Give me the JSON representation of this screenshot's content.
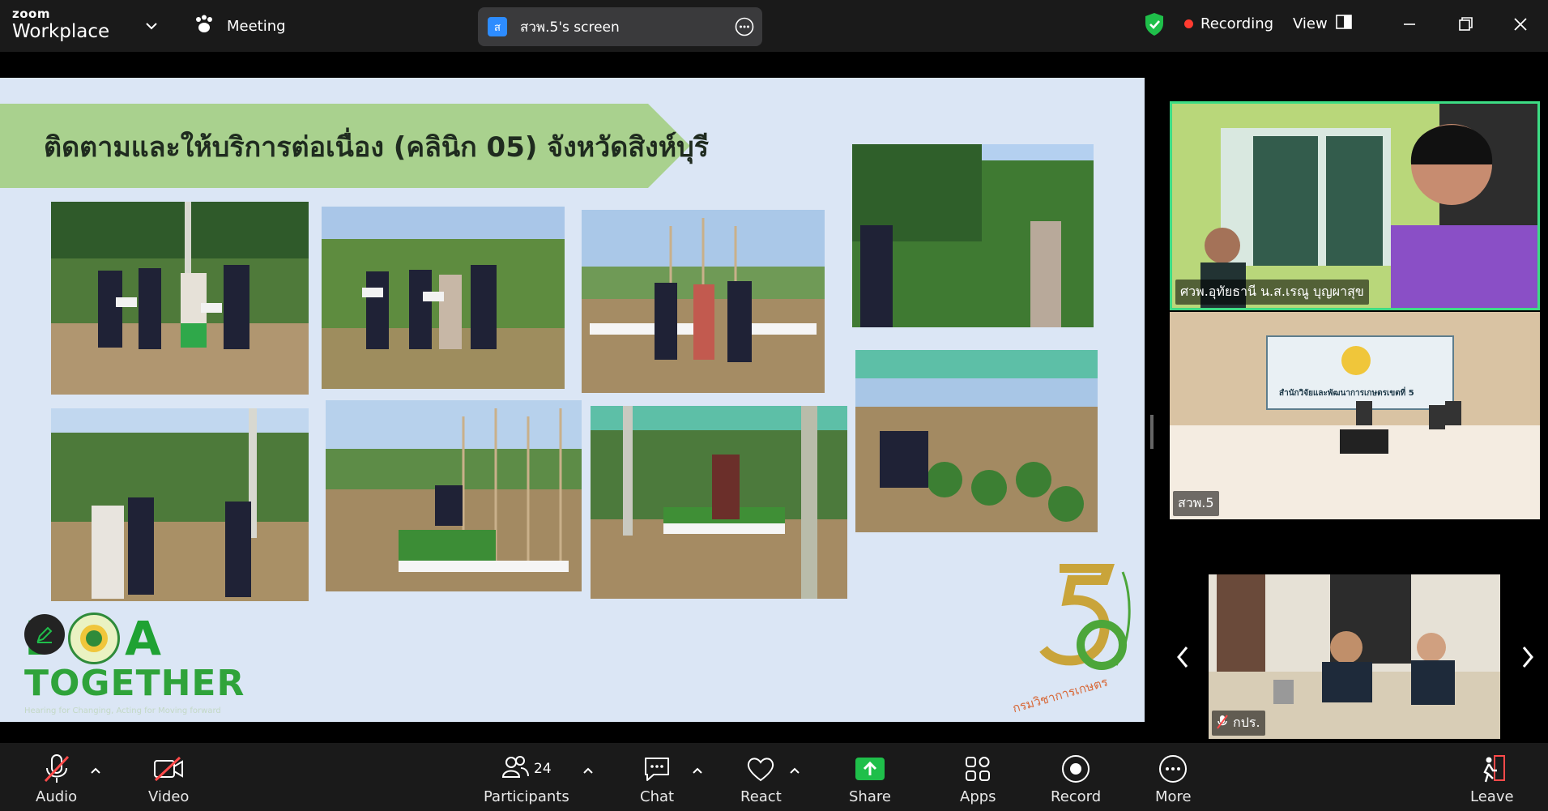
{
  "app": {
    "brand_small": "zoom",
    "brand_big": "Workplace"
  },
  "topbar": {
    "meeting_label": "Meeting",
    "screen_share": {
      "badge": "ส",
      "label": "สวพ.5's screen"
    },
    "recording_label": "Recording",
    "view_label": "View"
  },
  "slide": {
    "title": "ติดตามและให้บริการต่อเนื่อง (คลินิก 05) จังหวัดสิงห์บุรี",
    "logo_letters": [
      "D",
      "A"
    ],
    "logo_word": "TOGETHER",
    "logo_tagline": "Hearing for Changing, Acting for Moving forward",
    "anniv_vertical": "DOA TOGETHER",
    "anniv_dept": "กรมวิชาการเกษตร"
  },
  "gallery": {
    "tiles": [
      {
        "name": "ศวพ.อุทัยธานี น.ส.เรณู บุญผาสุข",
        "muted": false
      },
      {
        "name": "สวพ.5",
        "muted": false
      },
      {
        "name": "กปร.",
        "muted": true
      }
    ],
    "room_sign": "สำนักวิจัยและพัฒนาการเกษตรเขตที่ 5"
  },
  "toolbar": {
    "audio": "Audio",
    "video": "Video",
    "participants": "Participants",
    "participants_count": "24",
    "chat": "Chat",
    "react": "React",
    "share": "Share",
    "apps": "Apps",
    "record": "Record",
    "more": "More",
    "leave": "Leave"
  },
  "colors": {
    "share_green": "#1fbf4a",
    "record_red": "#ff3b30",
    "active_speaker": "#3ddc84",
    "leave_red": "#ff4a4a"
  }
}
